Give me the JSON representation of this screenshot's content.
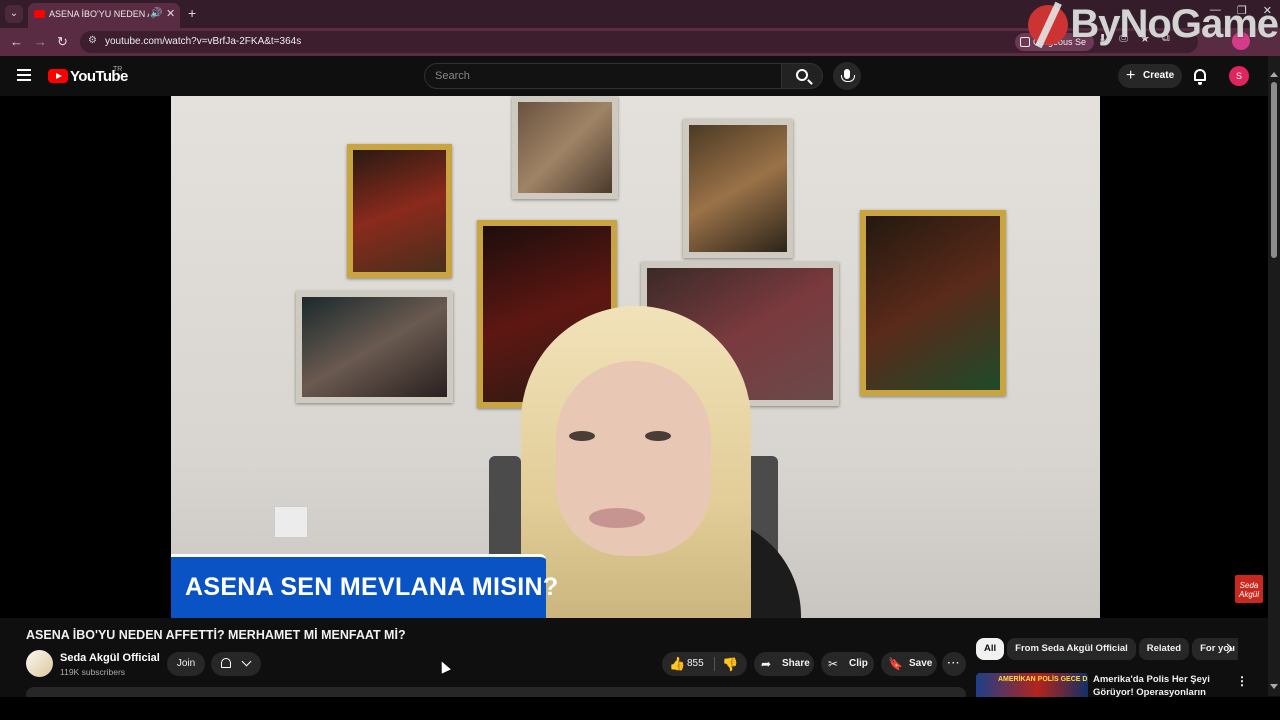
{
  "browser": {
    "tab_title": "ASENA İBO'YU NEDEN AFFETTİ? MERHAMET Mİ MENFAAT Mİ? - YouTube",
    "url": "youtube.com/watch?v=vBrfJa-2FKA&t=364s",
    "extension_chip": "Gorgeous Se",
    "icons": {
      "tab_search": "chevron-down-icon",
      "tab_audio": "speaker-icon",
      "tab_close": "close-icon",
      "new_tab": "plus-icon",
      "back": "back-arrow-icon",
      "forward": "forward-arrow-icon",
      "reload": "reload-icon",
      "site_info": "site-info-icon"
    },
    "glyphs": {
      "tab_search": "⌄",
      "tab_audio": "🔊",
      "tab_close": "✕",
      "new_tab": "+",
      "back": "←",
      "forward": "→",
      "reload": "↻",
      "site_info": "⚙",
      "minimize": "—",
      "maximize": "❐",
      "close": "✕",
      "ext1": "⬇",
      "ext2": "⎙",
      "ext3": "★",
      "ext4": "⧉"
    }
  },
  "watermark": {
    "text": "ByNoGame"
  },
  "youtube": {
    "logo_text": "YouTube",
    "region": "TR",
    "search_placeholder": "Search",
    "create_label": "Create",
    "avatar_initial": "S",
    "icons": {
      "menu": "hamburger-icon",
      "search": "search-icon",
      "mic": "microphone-icon",
      "notifications": "bell-icon"
    }
  },
  "video": {
    "lower_third": "ASENA SEN MEVLANA MISIN?",
    "channel_watermark": "Seda Akgül",
    "title": "ASENA İBO'YU NEDEN AFFETTİ? MERHAMET Mİ MENFAAT Mİ?",
    "channel_name": "Seda Akgül Official",
    "subscribers": "119K subscribers",
    "join_label": "Join",
    "likes": "855",
    "share_label": "Share",
    "clip_label": "Clip",
    "save_label": "Save",
    "more_label": "···",
    "glyphs": {
      "like": "👍",
      "dislike": "👍",
      "share": "➦",
      "clip": "✂",
      "save": "🔖"
    }
  },
  "sidebar": {
    "chips": [
      "All",
      "From Seda Akgül Official",
      "Related",
      "For you"
    ],
    "active_chip": "All",
    "recommendation": {
      "thumb_text": "AMERİKAN POLİS GECE DEVRİYESİ",
      "title": "Amerika'da Polis Her Şeyi Görüyor! Operasyonların Perde"
    }
  }
}
